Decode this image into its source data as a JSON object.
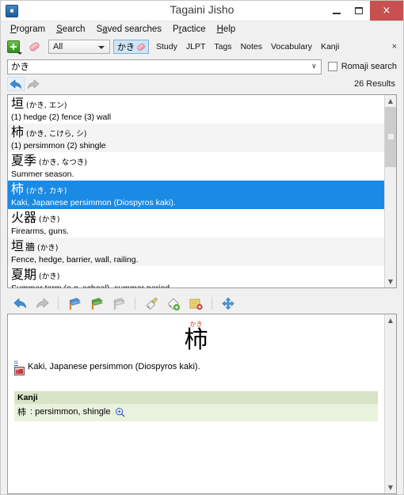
{
  "window": {
    "title": "Tagaini Jisho",
    "app_icon": "app-icon",
    "minimize_label": "Minimize",
    "maximize_label": "Maximize",
    "close_label": "×"
  },
  "menu": {
    "items": [
      {
        "pre": "P",
        "mnemonic": "r",
        "post": "ogram"
      },
      {
        "pre": "S",
        "mnemonic": "e",
        "post": "arch"
      },
      {
        "pre": "S",
        "mnemonic": "a",
        "post": "ved searches"
      },
      {
        "pre": "P",
        "mnemonic": "r",
        "post": "actice"
      },
      {
        "pre": "",
        "mnemonic": "H",
        "post": "elp"
      }
    ]
  },
  "toolbar": {
    "add_label": "",
    "clear_label": "",
    "scope_value": "All",
    "chip_label": "かき",
    "tabs": [
      "Study",
      "JLPT",
      "Tags",
      "Notes",
      "Vocabulary",
      "Kanji"
    ],
    "close_label": "×"
  },
  "search": {
    "value": "かき",
    "placeholder": "",
    "dropdown_glyph": "∨",
    "romaji_label": "Romaji search",
    "romaji_checked": false
  },
  "nav": {
    "back_label": "Back",
    "forward_label": "Forward",
    "results_count": "26 Results"
  },
  "results": {
    "items": [
      {
        "kanji": "垣",
        "kanji2": "",
        "reading": "(かき, エン)",
        "gloss": "(1) hedge (2) fence (3) wall",
        "selected": false
      },
      {
        "kanji": "柿",
        "kanji2": "",
        "reading": "(かき, こけら, シ)",
        "gloss": "(1) persimmon (2) shingle",
        "selected": false
      },
      {
        "kanji": "夏季",
        "kanji2": "",
        "reading": "(かき, なつき)",
        "gloss": "Summer season.",
        "selected": false
      },
      {
        "kanji": "柿",
        "kanji2": "",
        "reading": "(かき, カキ)",
        "gloss": "Kaki, Japanese persimmon (Diospyros kaki).",
        "selected": true
      },
      {
        "kanji": "火器",
        "kanji2": "",
        "reading": "(かき)",
        "gloss": "Firearms, guns.",
        "selected": false
      },
      {
        "kanji": "垣",
        "kanji2": "牆",
        "reading": "(かき)",
        "gloss": "Fence, hedge, barrier, wall, railing.",
        "selected": false
      },
      {
        "kanji": "夏期",
        "kanji2": "",
        "reading": "(かき)",
        "gloss": "Summer term (e.g. school), summer period.",
        "selected": false
      }
    ]
  },
  "detail_toolbar": {
    "buttons": [
      "back-icon",
      "forward-icon",
      "add-study-icon",
      "add-study-green-icon",
      "remove-study-icon",
      "tag-edit-icon",
      "tag-add-icon",
      "note-add-icon",
      "move-icon"
    ]
  },
  "detail": {
    "furigana": "かき",
    "headword": "柿",
    "pos_tag": "n",
    "sense": "Kaki, Japanese persimmon (Diospyros kaki).",
    "kanji_section_title": "Kanji",
    "kanji_entry_char": "柿",
    "kanji_entry_meaning": ": persimmon, shingle",
    "zoom_icon": "magnifier-plus-icon"
  },
  "colors": {
    "selection": "#1a8ae5",
    "furigana": "#e8341c",
    "section_header_bg": "#d8e3c8",
    "section_body_bg": "#e9f2dd",
    "close_button": "#c75050",
    "chip_bg": "#cfe4f7"
  }
}
